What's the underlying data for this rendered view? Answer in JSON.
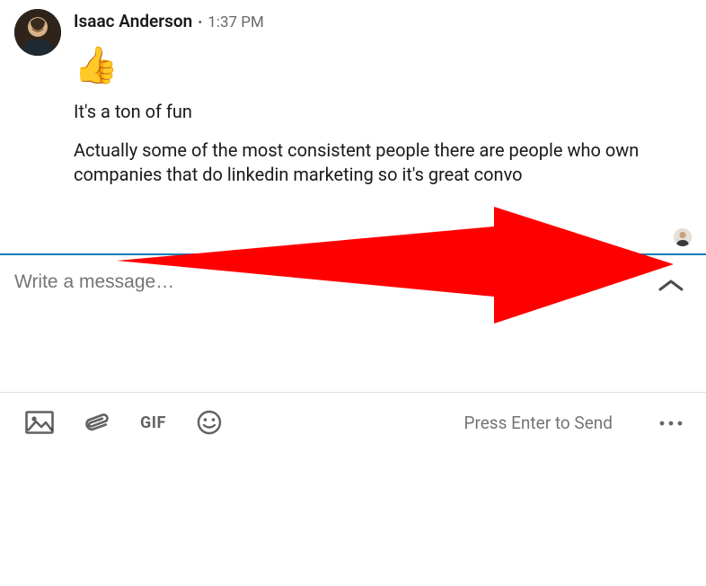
{
  "message": {
    "sender_name": "Isaac Anderson",
    "separator": "•",
    "timestamp": "1:37 PM",
    "reaction_emoji": "👍",
    "lines": [
      "It's a ton of fun",
      "Actually some of the most consistent people there are people who own companies that do linkedin marketing so it's great convo"
    ]
  },
  "compose": {
    "placeholder": "Write a message…",
    "enter_hint": "Press Enter to Send"
  },
  "toolbar": {
    "gif_label": "GIF"
  },
  "annotation": {
    "arrow_color": "#ff0000"
  }
}
